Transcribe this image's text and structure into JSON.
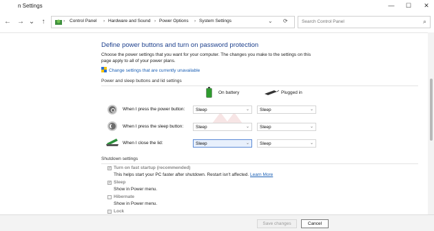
{
  "window": {
    "title": "n Settings"
  },
  "controls": {
    "minimize": "—",
    "maximize": "☐",
    "close": "✕"
  },
  "nav": {
    "back": "←",
    "forward": "→",
    "dropdown": "⌄",
    "up": "↑",
    "refresh": "⟳",
    "search_icon": "⌕"
  },
  "breadcrumb": {
    "items": [
      "Control Panel",
      "Hardware and Sound",
      "Power Options",
      "System Settings"
    ],
    "sep": "›"
  },
  "search": {
    "placeholder": "Search Control Panel"
  },
  "page": {
    "heading": "Define power buttons and turn on password protection",
    "description": "Choose the power settings that you want for your computer. The changes you make to the settings on this page apply to all of your power plans.",
    "change_link": "Change settings that are currently unavailable"
  },
  "power_section": {
    "title": "Power and sleep buttons and lid settings",
    "col_battery": "On battery",
    "col_plugged": "Plugged in",
    "rows": [
      {
        "label": "When I press the power button:",
        "battery": "Sleep",
        "plugged": "Sleep"
      },
      {
        "label": "When I press the sleep button:",
        "battery": "Sleep",
        "plugged": "Sleep"
      },
      {
        "label": "When I close the lid:",
        "battery": "Sleep",
        "plugged": "Sleep"
      }
    ]
  },
  "shutdown_section": {
    "title": "Shutdown settings",
    "items": [
      {
        "label": "Turn on fast startup (recommended)",
        "sub": "This helps start your PC faster after shutdown. Restart isn't affected.",
        "link": "Learn More",
        "checked": true
      },
      {
        "label": "Sleep",
        "sub": "Show in Power menu.",
        "checked": true
      },
      {
        "label": "Hibernate",
        "sub": "Show in Power menu.",
        "checked": false
      },
      {
        "label": "Lock",
        "sub": "",
        "checked": true
      }
    ]
  },
  "footer": {
    "save": "Save changes",
    "cancel": "Cancel"
  },
  "colors": {
    "heading": "#1c3f8c",
    "link": "#1a5fb4",
    "focus_border": "#5b8ad6"
  }
}
